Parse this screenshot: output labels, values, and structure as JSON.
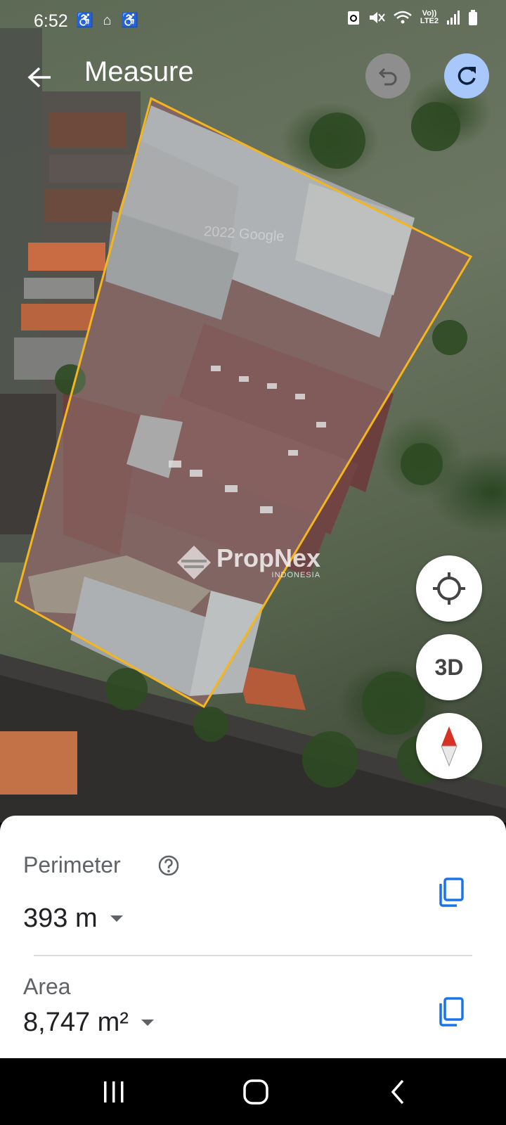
{
  "status_bar": {
    "time": "6:52",
    "notification_icons": "♿ ⌂ ♿",
    "network": "Vo))",
    "network_type": "LTE2"
  },
  "header": {
    "title": "Measure",
    "back_icon": "arrow-left-icon",
    "undo_icon": "undo-icon",
    "redo_icon": "redo-icon"
  },
  "map": {
    "copyright": "2022 Google",
    "watermark_name": "PropNex",
    "watermark_sub": "INDONESIA",
    "view_toggle": "3D",
    "measure_outline_color": "#f5b51c"
  },
  "measurement": {
    "perimeter_label": "Perimeter",
    "perimeter_value": "393 m",
    "area_label": "Area",
    "area_value": "8,747 m²"
  },
  "colors": {
    "redo_bg": "#a8c7fa",
    "undo_bg": "#8e8e8e",
    "copy_icon": "#1a73e8",
    "compass_red": "#d93025"
  }
}
